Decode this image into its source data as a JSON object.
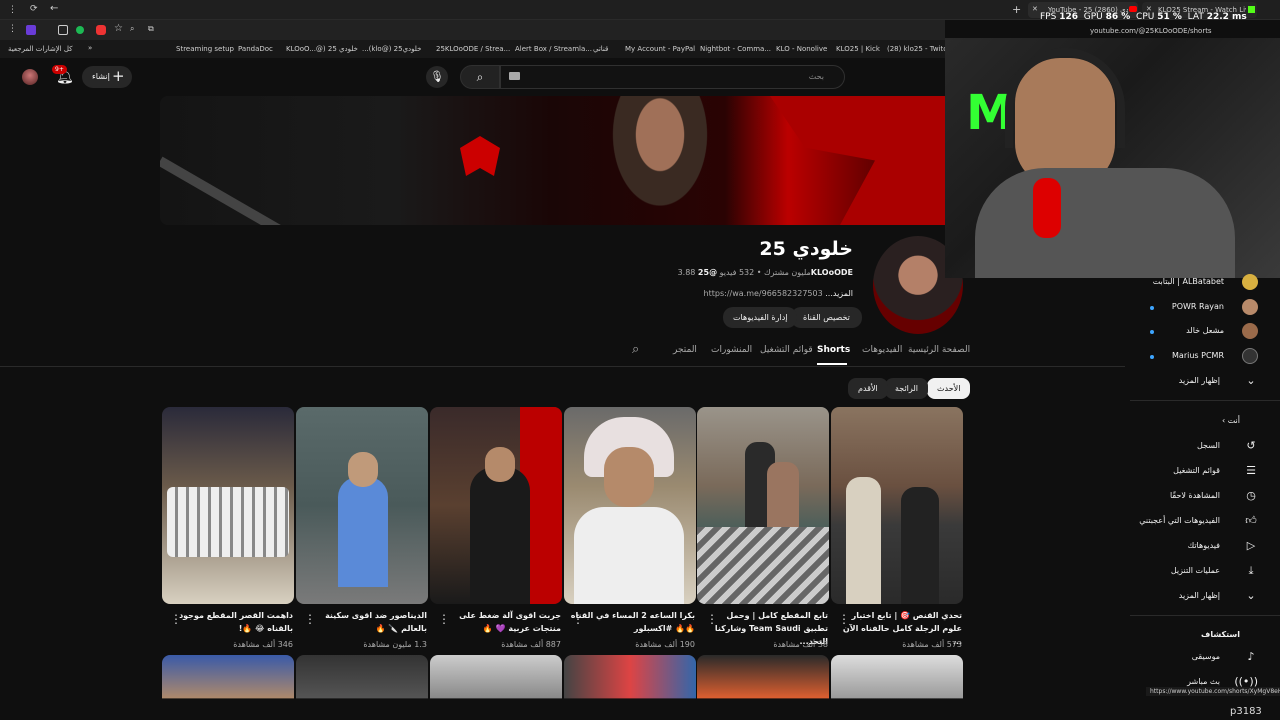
{
  "browser": {
    "tab1_title": "YouTube - 25 خلودي (2860)",
    "tab2_title": "KLO25 Stream - Watch Live on",
    "url": "youtube.com/@25KLOoODE/shorts",
    "stats": {
      "fps_label": "FPS",
      "fps": "126",
      "gpu_label": "GPU",
      "gpu": "86 %",
      "cpu_label": "CPU",
      "cpu": "51 %",
      "lat_label": "LAT",
      "lat": "22.2 ms"
    }
  },
  "bookmarks": {
    "all": "كل الإشارات المرجعية",
    "items": [
      "Streaming setup",
      "PandaDoc",
      "KLOoO...@) 25 خلودي",
      "...(klo@) 25خلودي",
      "25KLOoODE / Strea...",
      "Alert Box / Streamla...",
      "قناتي",
      "My Account - PayPal",
      "Nightbot - Comma...",
      "KLO - Nonolive",
      "KLO25 | Kick",
      "(28) klo25 - Twitch"
    ]
  },
  "header": {
    "create_label": "إنشاء",
    "notif_count": "9+",
    "search_placeholder": "بحث"
  },
  "channel": {
    "name": "خلودي 25",
    "handle": "@25KLOoODE",
    "meta": "3.88 مليون مشترك • 532 فيديو",
    "link": "https://wa.me/966582327503",
    "more": "...المزيد",
    "customize_button": "تخصيص القناة",
    "manage_button": "إدارة الفيديوهات"
  },
  "tabs": [
    "الصفحة الرئيسية",
    "الفيديوهات",
    "Shorts",
    "قوائم التشغيل",
    "المنشورات",
    "المتجر"
  ],
  "filters": [
    "الأحدث",
    "الرائجة",
    "الأقدم"
  ],
  "shorts": [
    {
      "title": "تحدي القنص 🎯 | تابع اختبار علوم الرجلة كامل حالفناه الآن ...",
      "views": "573 ألف مشاهدة"
    },
    {
      "title": "تابع المقطع كامل | وحمل تطبيق Team Saudi وشاركنا التحد...",
      "views": "38 ألف مشاهدة"
    },
    {
      "title": "بكرا الساعه 2 المساء في القناه 🔥🔥 #اكسبلور",
      "views": "190 ألف مشاهدة"
    },
    {
      "title": "جربت اقوى آلة ضغط على منتجات عربية 💜 🔥",
      "views": "887 ألف مشاهدة"
    },
    {
      "title": "الديناصور ضد اقوى سكينة بالعالم 🔪 🔥",
      "views": "1.3 مليون مشاهدة"
    },
    {
      "title": "داهمت القصر المقطع موجود بالقناه 😂 🔥!",
      "views": "346 ألف مشاهدة"
    }
  ],
  "sidebar": {
    "subs": [
      "ALBatabet | البتابت",
      "POWR Rayan",
      "مشعل خالد",
      "Marius PCMR"
    ],
    "show_more": "إظهار المزيد",
    "you_label": "أنت",
    "you_items": [
      "السجل",
      "قوائم التشغيل",
      "المشاهدة لاحقًا",
      "الفيديوهات التي أعجبتني",
      "فيديوهاتك",
      "عمليات التنزيل",
      "إظهار المزيد"
    ],
    "explore_label": "استكشاف",
    "explore_items": [
      "موسيقى",
      "بث مباشر"
    ]
  },
  "status_url": "https://www.youtube.com/shorts/XyMgV8eHSfA",
  "overlay_text": "p3183",
  "colors": {
    "accent": "#cc0000",
    "bg": "#0f0f0f",
    "link": "#3ea6ff"
  }
}
